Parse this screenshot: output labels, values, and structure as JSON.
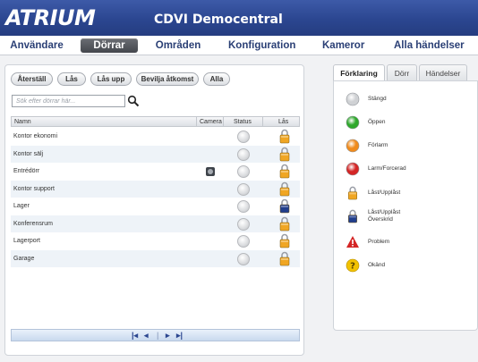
{
  "app": {
    "logo_text": "ATRIUM",
    "title": "CDVI Democentral"
  },
  "nav": [
    {
      "label": "Användare",
      "active": false
    },
    {
      "label": "Dörrar",
      "active": true
    },
    {
      "label": "Områden",
      "active": false
    },
    {
      "label": "Konfiguration",
      "active": false
    },
    {
      "label": "Kameror",
      "active": false
    },
    {
      "label": "Alla händelser",
      "active": false
    }
  ],
  "toolbar": {
    "reset": "Återställ",
    "lock": "Lås",
    "unlock": "Lås upp",
    "grant_access": "Bevilja åtkomst",
    "all": "Alla"
  },
  "search": {
    "placeholder": "Sök efter dörrar här...",
    "value": ""
  },
  "grid": {
    "columns": {
      "name": "Namn",
      "camera": "Camera",
      "status": "Status",
      "lock": "Lås"
    },
    "rows": [
      {
        "name": "Kontor ekonomi",
        "camera": false,
        "status": "Stängd",
        "lock": "Låst/Upplåst"
      },
      {
        "name": "Kontor sälj",
        "camera": false,
        "status": "Stängd",
        "lock": "Låst/Upplåst"
      },
      {
        "name": "Entrédörr",
        "camera": true,
        "status": "Stängd",
        "lock": "Låst/Upplåst"
      },
      {
        "name": "Kontor support",
        "camera": false,
        "status": "Stängd",
        "lock": "Låst/Upplåst"
      },
      {
        "name": "Lager",
        "camera": false,
        "status": "Stängd",
        "lock": "Låst/Upplåst Överskrid"
      },
      {
        "name": "Konferensrum",
        "camera": false,
        "status": "Stängd",
        "lock": "Låst/Upplåst"
      },
      {
        "name": "Lagerport",
        "camera": false,
        "status": "Stängd",
        "lock": "Låst/Upplåst"
      },
      {
        "name": "Garage",
        "camera": false,
        "status": "Stängd",
        "lock": "Låst/Upplåst"
      }
    ]
  },
  "pager": {
    "first": "first-page-icon",
    "prev": "prev-page-icon",
    "next": "next-page-icon",
    "last": "last-page-icon"
  },
  "right_tabs": [
    {
      "label": "Förklaring",
      "active": true
    },
    {
      "label": "Dörr",
      "active": false
    },
    {
      "label": "Händelser",
      "active": false
    }
  ],
  "legend": [
    {
      "icon": "status-closed-icon",
      "label": "Stängd"
    },
    {
      "icon": "status-open-icon",
      "label": "Öppen"
    },
    {
      "icon": "status-prealarm-icon",
      "label": "Förlarm"
    },
    {
      "icon": "status-forced-icon",
      "label": "Larm/Forcerad"
    },
    {
      "icon": "lock-icon",
      "label": "Låst/Upplåst"
    },
    {
      "icon": "lock-override-icon",
      "label": "Låst/Upplåst Överskrid"
    },
    {
      "icon": "warning-icon",
      "label": "Problem"
    },
    {
      "icon": "unknown-icon",
      "label": "Okänd"
    }
  ],
  "colors": {
    "header": "#2b4690",
    "open": "#2fa82c",
    "prealarm": "#f08b1c",
    "forced": "#d42525",
    "lock_gold": "#f0a623",
    "lock_blue": "#213e8c",
    "warning": "#d42525",
    "unknown": "#f2c200"
  }
}
